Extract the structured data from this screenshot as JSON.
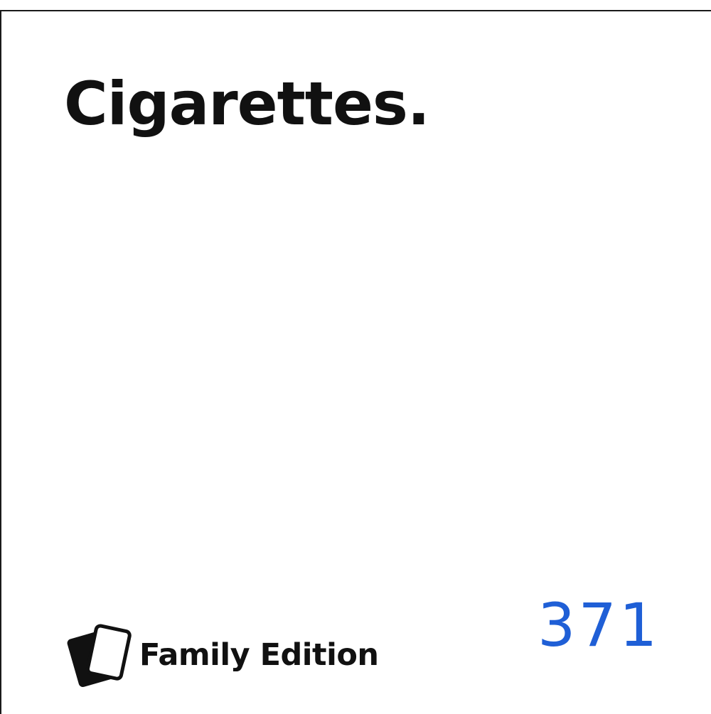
{
  "card": {
    "text": "Cigarettes.",
    "edition": "Family Edition",
    "number": "371"
  },
  "icons": {
    "logo": "stacked-cards-icon"
  },
  "colors": {
    "text": "#111111",
    "number": "#1f5fd6",
    "border": "#1a1a1a",
    "background": "#ffffff"
  }
}
